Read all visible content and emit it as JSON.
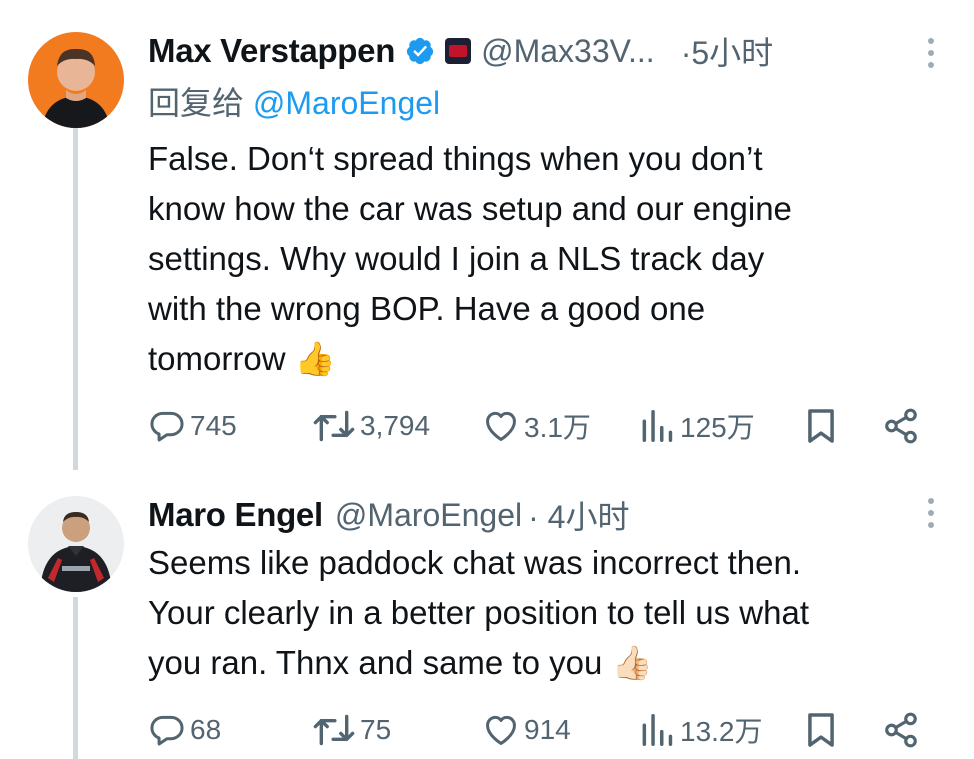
{
  "tweets": [
    {
      "author": "Max Verstappen",
      "handle": "@Max33V...",
      "time": "·5小时",
      "reply_to_prefix": "回复给",
      "reply_to_handle": "@MaroEngel",
      "text_lines": [
        "False. Don‘t spread things when you don’t",
        "know how the car was setup and our engine",
        "settings. Why would I join a NLS track day",
        "with the wrong BOP. Have a good one",
        "tomorrow 👍"
      ],
      "stats": {
        "replies": "745",
        "reposts": "3,794",
        "likes": "3.1万",
        "views": "125万"
      }
    },
    {
      "author": "Maro Engel",
      "handle": "@MaroEngel",
      "time": "· 4小时",
      "text_lines": [
        "Seems like paddock chat was incorrect then.",
        "Your clearly in a better position to tell us what",
        "you ran. Thnx and same to you 👍🏻"
      ],
      "stats": {
        "replies": "68",
        "reposts": "75",
        "likes": "914",
        "views": "13.2万"
      }
    }
  ],
  "colors": {
    "accent": "#1d9bf0",
    "secondary_text": "#536471",
    "thread_line": "#cfd9de",
    "verified": "#1d9bf0"
  },
  "icons": [
    "reply-icon",
    "repost-icon",
    "like-icon",
    "views-icon",
    "bookmark-icon",
    "share-icon",
    "more-icon",
    "verified-badge-icon",
    "affiliate-badge-icon"
  ]
}
